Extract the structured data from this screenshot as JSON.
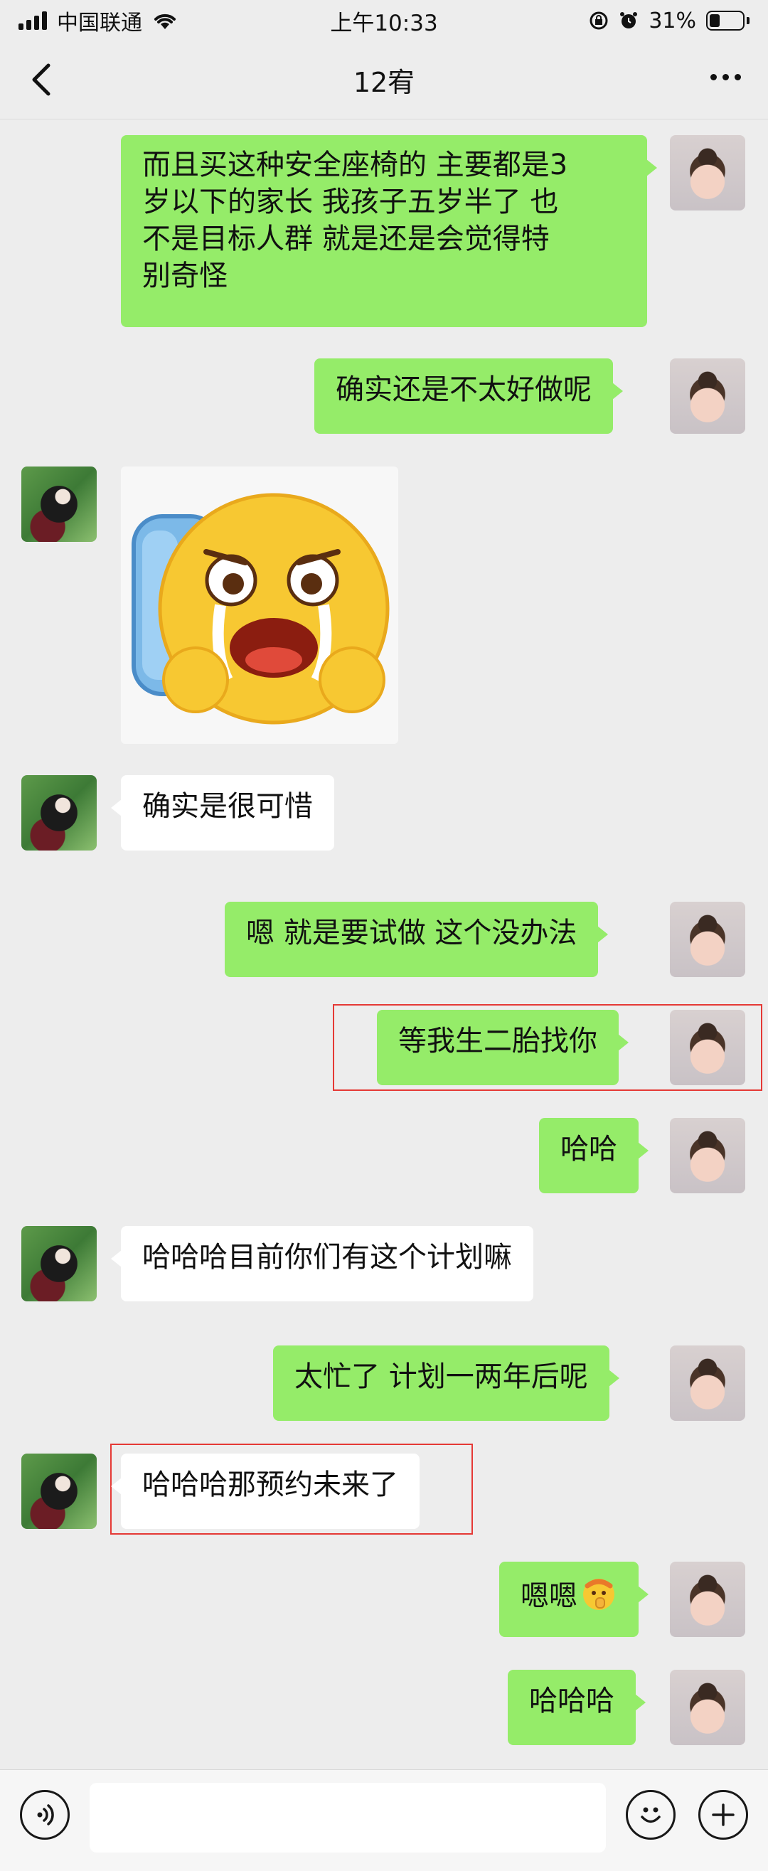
{
  "status_bar": {
    "carrier": "中国联通",
    "time": "上午10:33",
    "battery_percent_text": "31%",
    "battery_level": 0.31
  },
  "header": {
    "back_icon": "chevron-left-icon",
    "title": "12宥",
    "more_icon": "more-dots-icon"
  },
  "messages": [
    {
      "from": "me",
      "lines": [
        "而且买这种安全座椅的 主要都是3",
        "岁以下的家长  我孩子五岁半了 也",
        "不是目标人群  就是还是会觉得特",
        "别奇怪"
      ]
    },
    {
      "from": "me",
      "text": "确实还是不太好做呢"
    },
    {
      "from": "other",
      "type": "sticker",
      "sticker": "crying-face-backpack-sticker"
    },
    {
      "from": "other",
      "text": "确实是很可惜"
    },
    {
      "from": "me",
      "text": "嗯 就是要试做  这个没办法"
    },
    {
      "from": "me",
      "text": "等我生二胎找你",
      "highlighted": true
    },
    {
      "from": "me",
      "text": "哈哈"
    },
    {
      "from": "other",
      "text": "哈哈哈目前你们有这个计划嘛"
    },
    {
      "from": "me",
      "text": "太忙了 计划一两年后呢"
    },
    {
      "from": "other",
      "text": "哈哈哈那预约未来了",
      "highlighted": true
    },
    {
      "from": "me",
      "text": "嗯嗯",
      "emoji": "shushing-face-emoji"
    },
    {
      "from": "me",
      "text": "哈哈哈"
    }
  ],
  "input_bar": {
    "voice_icon": "voice-icon",
    "input_value": "",
    "emoji_icon": "emoji-icon",
    "plus_icon": "plus-icon"
  },
  "colors": {
    "background": "#ededed",
    "my_bubble": "#95ec69",
    "their_bubble": "#ffffff",
    "highlight_border": "#e53935"
  }
}
